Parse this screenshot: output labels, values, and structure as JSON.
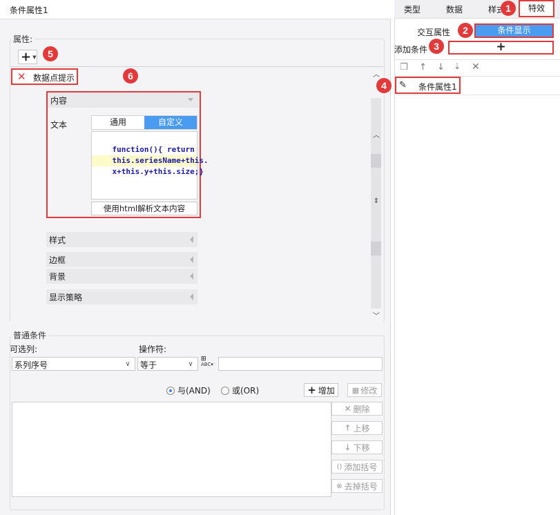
{
  "dialog": {
    "title": "条件属性1"
  },
  "attributes": {
    "group_label": "属性:",
    "add_button": "+",
    "delete_item_label": "数据点提示",
    "content_section": {
      "title": "内容",
      "text_label": "文本",
      "tab_general": "通用",
      "tab_custom": "自定义",
      "code_lines": [
        "function(){ return",
        "this.seriesName+this.",
        "x+this.y+this.size;}"
      ],
      "html_checkbox_label": "使用html解析文本内容"
    },
    "sections": [
      "样式",
      "边框",
      "背景",
      "显示策略"
    ]
  },
  "condition": {
    "group_label": "普通条件",
    "column_label": "可选列:",
    "operator_label": "操作符:",
    "column_value": "系列序号",
    "operator_value": "等于",
    "value_input": "",
    "radio_and": "与(AND)",
    "radio_or": "或(OR)",
    "add_button": "增加",
    "modify_button": "修改",
    "delete_button": "删除",
    "up_button": "上移",
    "down_button": "下移",
    "add_bracket_button": "添加括号",
    "remove_bracket_button": "去掉括号"
  },
  "right_panel": {
    "tabs": [
      "类型",
      "数据",
      "样式",
      "特效"
    ],
    "interaction_label": "交互属性",
    "conditional_display_button": "条件显示",
    "add_condition_label": "添加条件",
    "add_condition_button": "+",
    "list_items": [
      "条件属性1"
    ]
  },
  "badges": [
    "1",
    "2",
    "3",
    "4",
    "5",
    "6"
  ],
  "colors": {
    "accent": "#4a9cf0",
    "highlight": "#e23a3a",
    "code_keyword": "#1a1aa6",
    "code_line_highlight": "#fdfbc8"
  }
}
